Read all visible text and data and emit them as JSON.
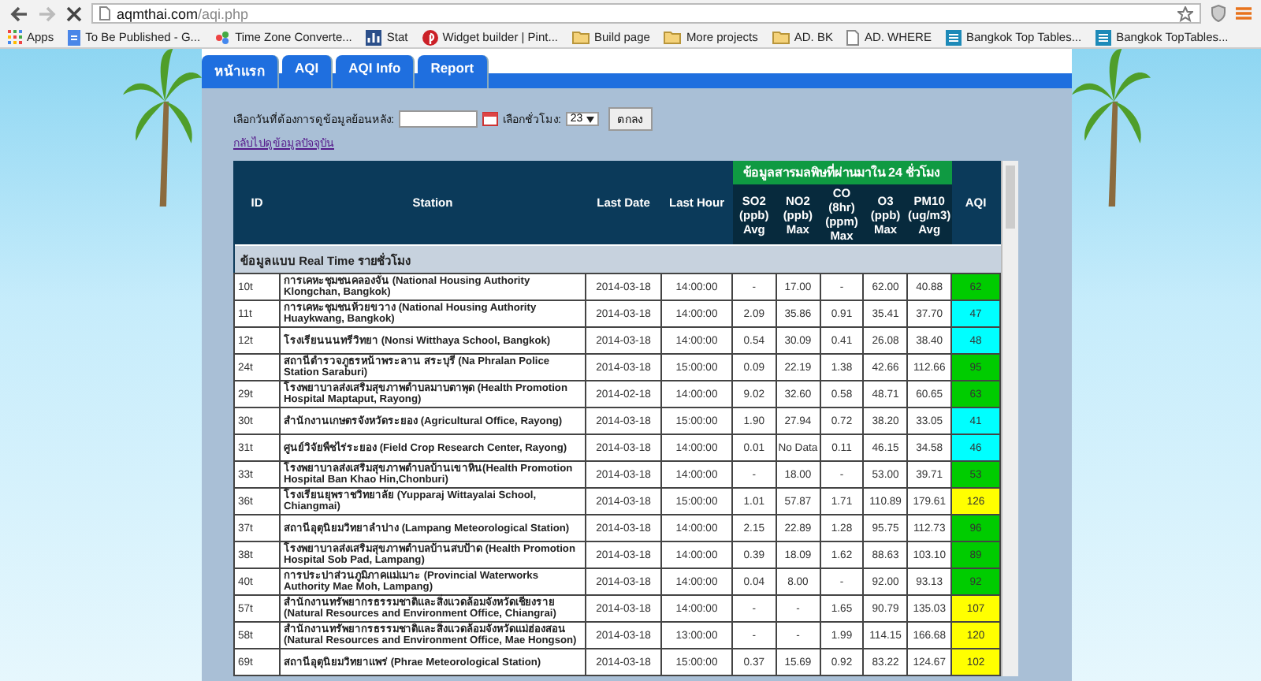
{
  "browser": {
    "url_host": "aqmthai.com",
    "url_path": "/aqi.php",
    "bookmarks": [
      {
        "kind": "apps",
        "label": "Apps"
      },
      {
        "kind": "doc",
        "label": "To Be Published - G..."
      },
      {
        "kind": "clock",
        "label": "Time Zone Converte..."
      },
      {
        "kind": "stat",
        "label": "Stat"
      },
      {
        "kind": "pin",
        "label": "Widget builder | Pint..."
      },
      {
        "kind": "folder",
        "label": "Build page"
      },
      {
        "kind": "folder",
        "label": "More projects"
      },
      {
        "kind": "folder",
        "label": "AD. BK"
      },
      {
        "kind": "page",
        "label": "AD. WHERE"
      },
      {
        "kind": "site",
        "label": "Bangkok Top Tables..."
      },
      {
        "kind": "site",
        "label": "Bangkok TopTables..."
      }
    ]
  },
  "tabs": [
    {
      "label": "หน้าแรก"
    },
    {
      "label": "AQI"
    },
    {
      "label": "AQI Info"
    },
    {
      "label": "Report"
    }
  ],
  "form": {
    "date_label": "เลือกวันที่ต้องการดูข้อมูลย้อนหลัง:",
    "hour_label": "เลือกชั่วโมง:",
    "hour_value": "23",
    "submit": "ตกลง",
    "back_link": "กลับไปดูข้อมูลปัจจุบัน"
  },
  "table": {
    "columns": [
      "ID",
      "Station",
      "Last Date",
      "Last Hour"
    ],
    "group_header": "ข้อมูลสารมลพิษที่ผ่านมาใน 24 ชั่วโมง",
    "pollutant_columns": [
      "SO2 (ppb) Avg",
      "NO2 (ppb) Max",
      "CO (8hr) (ppm) Max",
      "O3 (ppb) Max",
      "PM10 (ug/m3) Avg"
    ],
    "aqi_column": "AQI",
    "section": "ข้อมูลแบบ Real Time รายชั่วโมง",
    "rows": [
      {
        "id": "10t",
        "station": "การเคหะชุมชนคลองจั่น (National Housing Authority Klongchan, Bangkok)",
        "date": "2014-03-18",
        "hour": "14:00:00",
        "values": [
          "-",
          "17.00",
          "-",
          "62.00",
          "40.88"
        ],
        "aqi": "62",
        "color": "#00cc00"
      },
      {
        "id": "11t",
        "station": "การเคหะชุมชนห้วยขวาง (National Housing Authority Huaykwang, Bangkok)",
        "date": "2014-03-18",
        "hour": "14:00:00",
        "values": [
          "2.09",
          "35.86",
          "0.91",
          "35.41",
          "37.70"
        ],
        "aqi": "47",
        "color": "#00ffff"
      },
      {
        "id": "12t",
        "station": "โรงเรียนนนทรีวิทยา (Nonsi Witthaya School, Bangkok)",
        "date": "2014-03-18",
        "hour": "14:00:00",
        "values": [
          "0.54",
          "30.09",
          "0.41",
          "26.08",
          "38.40"
        ],
        "aqi": "48",
        "color": "#00ffff"
      },
      {
        "id": "24t",
        "station": "สถานีตำรวจภูธรหน้าพระลาน สระบุรี (Na Phralan Police Station Saraburi)",
        "date": "2014-03-18",
        "hour": "15:00:00",
        "values": [
          "0.09",
          "22.19",
          "1.38",
          "42.66",
          "112.66"
        ],
        "aqi": "95",
        "color": "#00cc00"
      },
      {
        "id": "29t",
        "station": "โรงพยาบาลส่งเสริมสุขภาพตำบลมาบตาพุด (Health Promotion Hospital Maptaput, Rayong)",
        "date": "2014-02-18",
        "hour": "14:00:00",
        "values": [
          "9.02",
          "32.60",
          "0.58",
          "48.71",
          "60.65"
        ],
        "aqi": "63",
        "color": "#00cc00"
      },
      {
        "id": "30t",
        "station": "สำนักงานเกษตรจังหวัดระยอง (Agricultural Office, Rayong)",
        "date": "2014-03-18",
        "hour": "15:00:00",
        "values": [
          "1.90",
          "27.94",
          "0.72",
          "38.20",
          "33.05"
        ],
        "aqi": "41",
        "color": "#00ffff"
      },
      {
        "id": "31t",
        "station": "ศูนย์วิจัยพืชไร่ระยอง (Field Crop Research Center, Rayong)",
        "date": "2014-03-18",
        "hour": "14:00:00",
        "values": [
          "0.01",
          "No Data",
          "0.11",
          "46.15",
          "34.58"
        ],
        "aqi": "46",
        "color": "#00ffff"
      },
      {
        "id": "33t",
        "station": "โรงพยาบาลส่งเสริมสุขภาพตำบลบ้านเขาหิน(Health Promotion Hospital Ban Khao Hin,Chonburi)",
        "date": "2014-03-18",
        "hour": "14:00:00",
        "values": [
          "-",
          "18.00",
          "-",
          "53.00",
          "39.71"
        ],
        "aqi": "53",
        "color": "#00cc00"
      },
      {
        "id": "36t",
        "station": "โรงเรียนยุพราชวิทยาลัย (Yupparaj Wittayalai School, Chiangmai)",
        "date": "2014-03-18",
        "hour": "15:00:00",
        "values": [
          "1.01",
          "57.87",
          "1.71",
          "110.89",
          "179.61"
        ],
        "aqi": "126",
        "color": "#ffff00"
      },
      {
        "id": "37t",
        "station": "สถานีอุตุนิยมวิทยาลำปาง (Lampang Meteorological Station)",
        "date": "2014-03-18",
        "hour": "14:00:00",
        "values": [
          "2.15",
          "22.89",
          "1.28",
          "95.75",
          "112.73"
        ],
        "aqi": "96",
        "color": "#00cc00"
      },
      {
        "id": "38t",
        "station": "โรงพยาบาลส่งเสริมสุขภาพตำบลบ้านสบป้าด (Health Promotion Hospital Sob Pad, Lampang)",
        "date": "2014-03-18",
        "hour": "14:00:00",
        "values": [
          "0.39",
          "18.09",
          "1.62",
          "88.63",
          "103.10"
        ],
        "aqi": "89",
        "color": "#00cc00"
      },
      {
        "id": "40t",
        "station": "การประปาส่วนภูมิภาคแม่เมาะ (Provincial Waterworks Authority Mae Moh, Lampang)",
        "date": "2014-03-18",
        "hour": "14:00:00",
        "values": [
          "0.04",
          "8.00",
          "-",
          "92.00",
          "93.13"
        ],
        "aqi": "92",
        "color": "#00cc00"
      },
      {
        "id": "57t",
        "station": "สำนักงานทรัพยากรธรรมชาติและสิ่งแวดล้อมจังหวัดเชียงราย (Natural Resources and Environment Office, Chiangrai)",
        "date": "2014-03-18",
        "hour": "14:00:00",
        "values": [
          "-",
          "-",
          "1.65",
          "90.79",
          "135.03"
        ],
        "aqi": "107",
        "color": "#ffff00"
      },
      {
        "id": "58t",
        "station": "สำนักงานทรัพยากรธรรมชาติและสิ่งแวดล้อมจังหวัดแม่ฮ่องสอน (Natural Resources and Environment Office, Mae Hongson)",
        "date": "2014-03-18",
        "hour": "13:00:00",
        "values": [
          "-",
          "-",
          "1.99",
          "114.15",
          "166.68"
        ],
        "aqi": "120",
        "color": "#ffff00"
      },
      {
        "id": "69t",
        "station": "สถานีอุตุนิยมวิทยาแพร่ (Phrae Meteorological Station)",
        "date": "2014-03-18",
        "hour": "15:00:00",
        "values": [
          "0.37",
          "15.69",
          "0.92",
          "83.22",
          "124.67"
        ],
        "aqi": "102",
        "color": "#ffff00"
      }
    ]
  }
}
